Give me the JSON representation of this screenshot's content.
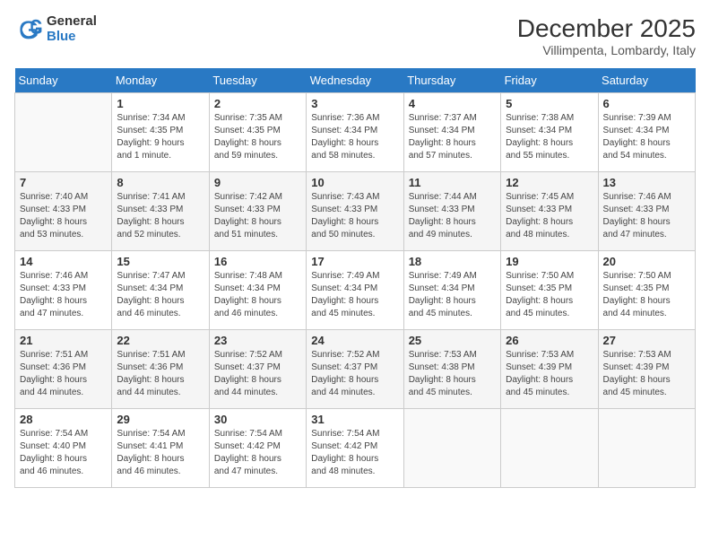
{
  "logo": {
    "general": "General",
    "blue": "Blue"
  },
  "title": "December 2025",
  "subtitle": "Villimpenta, Lombardy, Italy",
  "days_of_week": [
    "Sunday",
    "Monday",
    "Tuesday",
    "Wednesday",
    "Thursday",
    "Friday",
    "Saturday"
  ],
  "weeks": [
    [
      {
        "day": "",
        "info": ""
      },
      {
        "day": "1",
        "info": "Sunrise: 7:34 AM\nSunset: 4:35 PM\nDaylight: 9 hours\nand 1 minute."
      },
      {
        "day": "2",
        "info": "Sunrise: 7:35 AM\nSunset: 4:35 PM\nDaylight: 8 hours\nand 59 minutes."
      },
      {
        "day": "3",
        "info": "Sunrise: 7:36 AM\nSunset: 4:34 PM\nDaylight: 8 hours\nand 58 minutes."
      },
      {
        "day": "4",
        "info": "Sunrise: 7:37 AM\nSunset: 4:34 PM\nDaylight: 8 hours\nand 57 minutes."
      },
      {
        "day": "5",
        "info": "Sunrise: 7:38 AM\nSunset: 4:34 PM\nDaylight: 8 hours\nand 55 minutes."
      },
      {
        "day": "6",
        "info": "Sunrise: 7:39 AM\nSunset: 4:34 PM\nDaylight: 8 hours\nand 54 minutes."
      }
    ],
    [
      {
        "day": "7",
        "info": "Sunrise: 7:40 AM\nSunset: 4:33 PM\nDaylight: 8 hours\nand 53 minutes."
      },
      {
        "day": "8",
        "info": "Sunrise: 7:41 AM\nSunset: 4:33 PM\nDaylight: 8 hours\nand 52 minutes."
      },
      {
        "day": "9",
        "info": "Sunrise: 7:42 AM\nSunset: 4:33 PM\nDaylight: 8 hours\nand 51 minutes."
      },
      {
        "day": "10",
        "info": "Sunrise: 7:43 AM\nSunset: 4:33 PM\nDaylight: 8 hours\nand 50 minutes."
      },
      {
        "day": "11",
        "info": "Sunrise: 7:44 AM\nSunset: 4:33 PM\nDaylight: 8 hours\nand 49 minutes."
      },
      {
        "day": "12",
        "info": "Sunrise: 7:45 AM\nSunset: 4:33 PM\nDaylight: 8 hours\nand 48 minutes."
      },
      {
        "day": "13",
        "info": "Sunrise: 7:46 AM\nSunset: 4:33 PM\nDaylight: 8 hours\nand 47 minutes."
      }
    ],
    [
      {
        "day": "14",
        "info": "Sunrise: 7:46 AM\nSunset: 4:33 PM\nDaylight: 8 hours\nand 47 minutes."
      },
      {
        "day": "15",
        "info": "Sunrise: 7:47 AM\nSunset: 4:34 PM\nDaylight: 8 hours\nand 46 minutes."
      },
      {
        "day": "16",
        "info": "Sunrise: 7:48 AM\nSunset: 4:34 PM\nDaylight: 8 hours\nand 46 minutes."
      },
      {
        "day": "17",
        "info": "Sunrise: 7:49 AM\nSunset: 4:34 PM\nDaylight: 8 hours\nand 45 minutes."
      },
      {
        "day": "18",
        "info": "Sunrise: 7:49 AM\nSunset: 4:34 PM\nDaylight: 8 hours\nand 45 minutes."
      },
      {
        "day": "19",
        "info": "Sunrise: 7:50 AM\nSunset: 4:35 PM\nDaylight: 8 hours\nand 45 minutes."
      },
      {
        "day": "20",
        "info": "Sunrise: 7:50 AM\nSunset: 4:35 PM\nDaylight: 8 hours\nand 44 minutes."
      }
    ],
    [
      {
        "day": "21",
        "info": "Sunrise: 7:51 AM\nSunset: 4:36 PM\nDaylight: 8 hours\nand 44 minutes."
      },
      {
        "day": "22",
        "info": "Sunrise: 7:51 AM\nSunset: 4:36 PM\nDaylight: 8 hours\nand 44 minutes."
      },
      {
        "day": "23",
        "info": "Sunrise: 7:52 AM\nSunset: 4:37 PM\nDaylight: 8 hours\nand 44 minutes."
      },
      {
        "day": "24",
        "info": "Sunrise: 7:52 AM\nSunset: 4:37 PM\nDaylight: 8 hours\nand 44 minutes."
      },
      {
        "day": "25",
        "info": "Sunrise: 7:53 AM\nSunset: 4:38 PM\nDaylight: 8 hours\nand 45 minutes."
      },
      {
        "day": "26",
        "info": "Sunrise: 7:53 AM\nSunset: 4:39 PM\nDaylight: 8 hours\nand 45 minutes."
      },
      {
        "day": "27",
        "info": "Sunrise: 7:53 AM\nSunset: 4:39 PM\nDaylight: 8 hours\nand 45 minutes."
      }
    ],
    [
      {
        "day": "28",
        "info": "Sunrise: 7:54 AM\nSunset: 4:40 PM\nDaylight: 8 hours\nand 46 minutes."
      },
      {
        "day": "29",
        "info": "Sunrise: 7:54 AM\nSunset: 4:41 PM\nDaylight: 8 hours\nand 46 minutes."
      },
      {
        "day": "30",
        "info": "Sunrise: 7:54 AM\nSunset: 4:42 PM\nDaylight: 8 hours\nand 47 minutes."
      },
      {
        "day": "31",
        "info": "Sunrise: 7:54 AM\nSunset: 4:42 PM\nDaylight: 8 hours\nand 48 minutes."
      },
      {
        "day": "",
        "info": ""
      },
      {
        "day": "",
        "info": ""
      },
      {
        "day": "",
        "info": ""
      }
    ]
  ]
}
